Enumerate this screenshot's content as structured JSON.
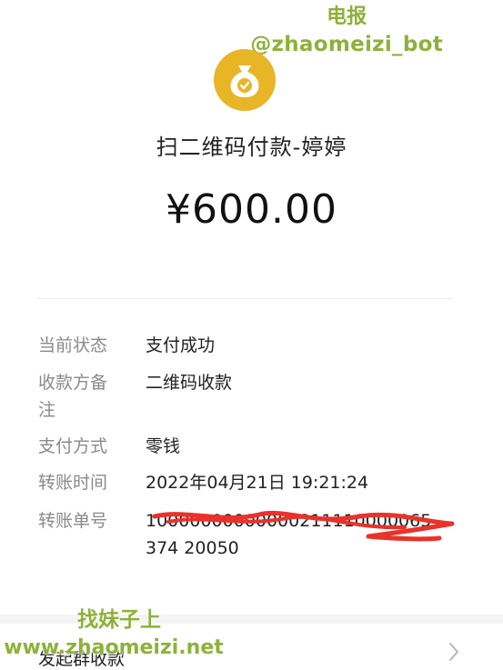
{
  "watermark_top": {
    "line1": "电报",
    "line2": "@zhaomeizi_bot"
  },
  "header": {
    "icon": "money-bag-check-icon",
    "title": "扫二维码付款-婷婷",
    "amount": "¥600.00"
  },
  "details": [
    {
      "label": "当前状态",
      "value": "支付成功"
    },
    {
      "label": "收款方备注",
      "value": "二维码收款"
    },
    {
      "label": "支付方式",
      "value": "零钱"
    },
    {
      "label": "转账时间",
      "value": "2022年04月21日 19:21:24"
    },
    {
      "label": "转账单号",
      "value": "10000000000000211110000065374 20050"
    }
  ],
  "footer": {
    "label": "发起群收款",
    "chevron": "chevron-right-icon"
  },
  "watermark_bottom": {
    "line1": "找妹子上",
    "line2": "www.zhaomeizi.net"
  },
  "colors": {
    "icon_bg": "#e8b527",
    "watermark": "#8db23a",
    "scribble": "#e8322a"
  }
}
